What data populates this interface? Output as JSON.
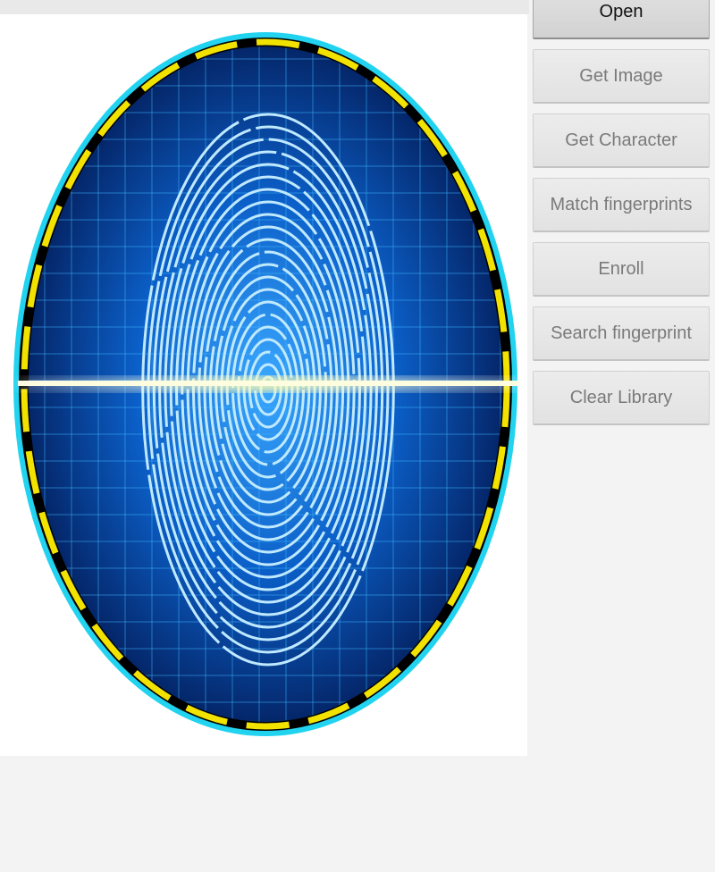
{
  "buttons": [
    {
      "id": "open",
      "label": "Open",
      "enabled": true
    },
    {
      "id": "get-image",
      "label": "Get Image",
      "enabled": false
    },
    {
      "id": "get-character",
      "label": "Get Character",
      "enabled": false
    },
    {
      "id": "match-fingerprints",
      "label": "Match fingerprints",
      "enabled": false
    },
    {
      "id": "enroll",
      "label": "Enroll",
      "enabled": false
    },
    {
      "id": "search-fingerprint",
      "label": "Search fingerprint",
      "enabled": false
    },
    {
      "id": "clear-library",
      "label": "Clear Library",
      "enabled": false
    }
  ],
  "colors": {
    "ring": "#22d3f0",
    "dash": "#f2e200",
    "scan_line": "#fff8a0",
    "fingerprint_bg": "#0a4fb0"
  }
}
